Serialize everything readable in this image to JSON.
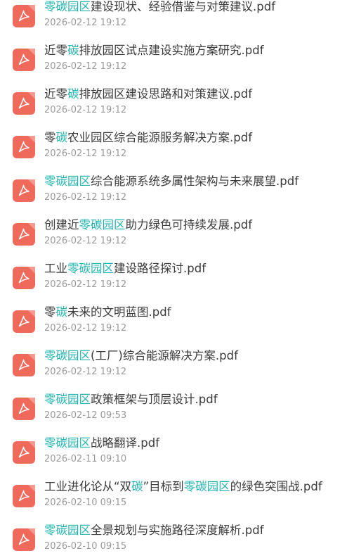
{
  "icon": "pdf-file-icon",
  "colors": {
    "highlight": "#21b4b0",
    "title_text": "#3b3b3b",
    "timestamp_text": "#9a9a9a",
    "pdf_icon_bg": "#ef6a5a"
  },
  "files": [
    {
      "title_parts": [
        {
          "text": "零碳园区",
          "hl": true
        },
        {
          "text": "建设现状、经验借鉴与对策建议.pdf",
          "hl": false
        }
      ],
      "time": "2026-02-12 19:12"
    },
    {
      "title_parts": [
        {
          "text": "近零",
          "hl": false
        },
        {
          "text": "碳",
          "hl": true
        },
        {
          "text": "排放园区试点建设实施方案研究.pdf",
          "hl": false
        }
      ],
      "time": "2026-02-12 19:12"
    },
    {
      "title_parts": [
        {
          "text": "近零",
          "hl": false
        },
        {
          "text": "碳",
          "hl": true
        },
        {
          "text": "排放园区建设思路和对策建议.pdf",
          "hl": false
        }
      ],
      "time": "2026-02-12 19:12"
    },
    {
      "title_parts": [
        {
          "text": "零",
          "hl": false
        },
        {
          "text": "碳",
          "hl": true
        },
        {
          "text": "农业园区综合能源服务解决方案.pdf",
          "hl": false
        }
      ],
      "time": "2026-02-12 19:12"
    },
    {
      "title_parts": [
        {
          "text": "零碳园区",
          "hl": true
        },
        {
          "text": "综合能源系统多属性架构与未来展望.pdf",
          "hl": false
        }
      ],
      "time": "2026-02-12 19:12"
    },
    {
      "title_parts": [
        {
          "text": "创建近",
          "hl": false
        },
        {
          "text": "零碳园区",
          "hl": true
        },
        {
          "text": "助力绿色可持续发展.pdf",
          "hl": false
        }
      ],
      "time": "2026-02-12 19:12"
    },
    {
      "title_parts": [
        {
          "text": "工业",
          "hl": false
        },
        {
          "text": "零碳园区",
          "hl": true
        },
        {
          "text": "建设路径探讨.pdf",
          "hl": false
        }
      ],
      "time": "2026-02-12 19:12"
    },
    {
      "title_parts": [
        {
          "text": "零",
          "hl": false
        },
        {
          "text": "碳",
          "hl": true
        },
        {
          "text": "未来的文明蓝图.pdf",
          "hl": false
        }
      ],
      "time": "2026-02-12 19:12"
    },
    {
      "title_parts": [
        {
          "text": "零碳园区",
          "hl": true
        },
        {
          "text": "(工厂)综合能源解决方案.pdf",
          "hl": false
        }
      ],
      "time": "2026-02-12 19:12"
    },
    {
      "title_parts": [
        {
          "text": "零碳园区",
          "hl": true
        },
        {
          "text": "政策框架与顶层设计.pdf",
          "hl": false
        }
      ],
      "time": "2026-02-12 09:53"
    },
    {
      "title_parts": [
        {
          "text": "零碳园区",
          "hl": true
        },
        {
          "text": "战略翻译.pdf",
          "hl": false
        }
      ],
      "time": "2026-02-11 09:10"
    },
    {
      "title_parts": [
        {
          "text": "工业进化论从“双",
          "hl": false
        },
        {
          "text": "碳",
          "hl": true
        },
        {
          "text": "”目标到",
          "hl": false
        },
        {
          "text": "零碳园区",
          "hl": true
        },
        {
          "text": "的绿色突围战.pdf",
          "hl": false
        }
      ],
      "time": "2026-02-10 09:15"
    },
    {
      "title_parts": [
        {
          "text": "零碳园区",
          "hl": true
        },
        {
          "text": "全景规划与实施路径深度解析.pdf",
          "hl": false
        }
      ],
      "time": "2026-02-10 09:15"
    }
  ]
}
